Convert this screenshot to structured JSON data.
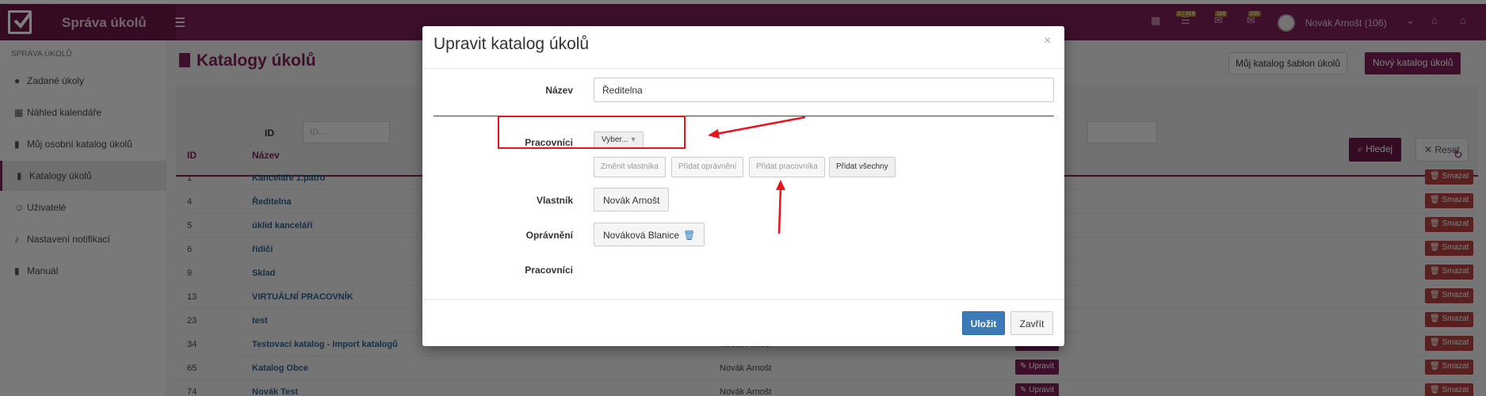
{
  "app": {
    "brand": "Správa úkolů",
    "user_name": "Novák Arnošt (106)",
    "badges": [
      "2 / 319",
      "118",
      "230"
    ]
  },
  "sidebar": {
    "section_title": "SPRÁVA ÚKOLŮ",
    "items": [
      {
        "label": "Zadané úkoly",
        "icon": "check-circle-icon"
      },
      {
        "label": "Náhled kalendáře",
        "icon": "calendar-icon"
      },
      {
        "label": "Můj osobní katalog úkolů",
        "icon": "book-icon"
      },
      {
        "label": "Katalogy úkolů",
        "icon": "book-icon"
      },
      {
        "label": "Uživatelé",
        "icon": "users-icon"
      },
      {
        "label": "Nastavení notifikací",
        "icon": "bell-icon"
      },
      {
        "label": "Manuál",
        "icon": "book-icon"
      }
    ]
  },
  "page": {
    "title": "Katalogy úkolů",
    "template_button": "Můj katalog šablon úkolů",
    "new_button": "Nový katalog úkolů"
  },
  "filter": {
    "id_label": "ID",
    "id_placeholder": "ID...",
    "search_button": "Hledej",
    "reset_button": "Reset"
  },
  "table": {
    "headers": {
      "id": "ID",
      "name": "Název"
    },
    "edit_label": "Upravit",
    "delete_label": "Smazat",
    "rows": [
      {
        "id": "1",
        "name": "Kanceláře 1.patro",
        "owner": ""
      },
      {
        "id": "4",
        "name": "Ředitelna",
        "owner": ""
      },
      {
        "id": "5",
        "name": "úklid kanceláří",
        "owner": ""
      },
      {
        "id": "6",
        "name": "řidiči",
        "owner": ""
      },
      {
        "id": "9",
        "name": "Sklad",
        "owner": ""
      },
      {
        "id": "13",
        "name": "VIRTUÁLNÍ PRACOVNÍK",
        "owner": ""
      },
      {
        "id": "23",
        "name": "test",
        "owner": ""
      },
      {
        "id": "34",
        "name": "Testovací katalog - Import katalogů",
        "owner": "Novák Arnošt"
      },
      {
        "id": "65",
        "name": "Katalog Obce",
        "owner": "Novák Arnošt"
      },
      {
        "id": "74",
        "name": "Novák Test",
        "owner": "Novák Arnošt"
      }
    ]
  },
  "modal": {
    "title": "Upravit katalog úkolů",
    "close_symbol": "×",
    "name_label": "Název",
    "name_value": "Ředitelna",
    "workers_label": "Pracovníci",
    "select_placeholder": "Vyber...",
    "action_buttons": [
      "Změnit vlastníka",
      "Přidat oprávnění",
      "Přidat pracovníka",
      "Přidat všechny"
    ],
    "owner_label": "Vlastník",
    "owner_value": "Novák Arnošt",
    "permissions_label": "Oprávnění",
    "permissions_value": "Nováková Blanice",
    "workers_label_2": "Pracovníci",
    "save_button": "Uložit",
    "close_button": "Zavřít"
  },
  "colors": {
    "brand": "#7a1e56",
    "save": "#3b79b7",
    "annotation": "#e8141e"
  }
}
